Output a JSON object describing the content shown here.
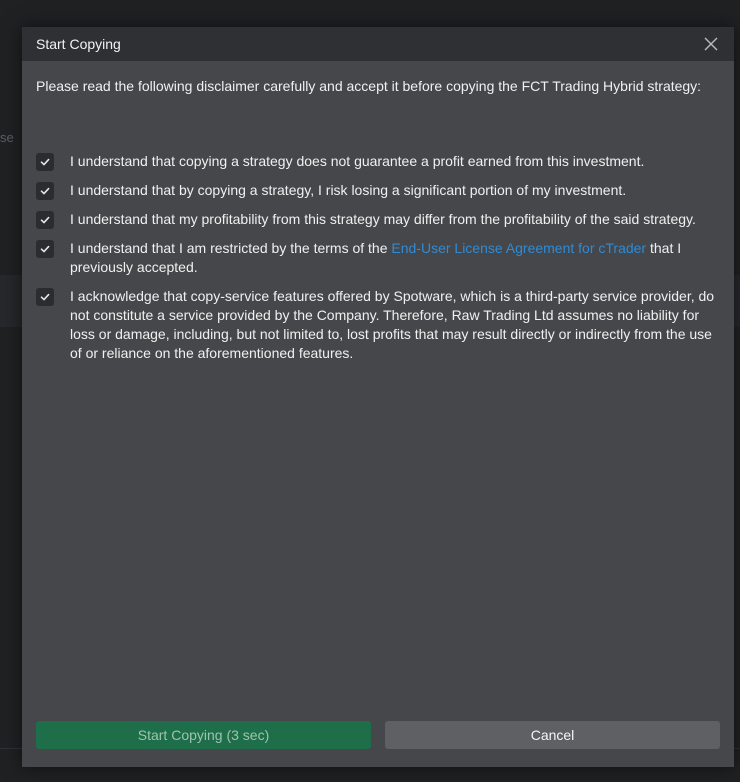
{
  "background": {
    "edge_text": "se"
  },
  "dialog": {
    "title": "Start Copying",
    "intro": "Please read the following disclaimer carefully and accept it before copying the FCT Trading Hybrid strategy:",
    "items": [
      {
        "checked": true,
        "text": "I understand that copying a strategy does not guarantee a profit earned from this investment."
      },
      {
        "checked": true,
        "text": "I understand that by copying a strategy, I risk losing a significant portion of my investment."
      },
      {
        "checked": true,
        "text": "I understand that my profitability from this strategy may differ from the profitability of the said strategy."
      },
      {
        "checked": true,
        "text_before": "I understand that I am restricted by the terms of the ",
        "link": "End-User License Agreement for cTrader",
        "text_after": " that I previously accepted."
      },
      {
        "checked": true,
        "text": "I acknowledge that copy-service features offered by Spotware, which is a third-party service provider, do not constitute a service provided by the Company. Therefore, Raw Trading Ltd assumes no liability for loss or damage, including, but not limited to, lost profits that may result directly or indirectly from the use of or reliance on the aforementioned features."
      }
    ],
    "start_label": "Start Copying (3 sec)",
    "cancel_label": "Cancel"
  },
  "colors": {
    "accent_green": "#1f6e4a",
    "link_blue": "#2f8bd6"
  }
}
